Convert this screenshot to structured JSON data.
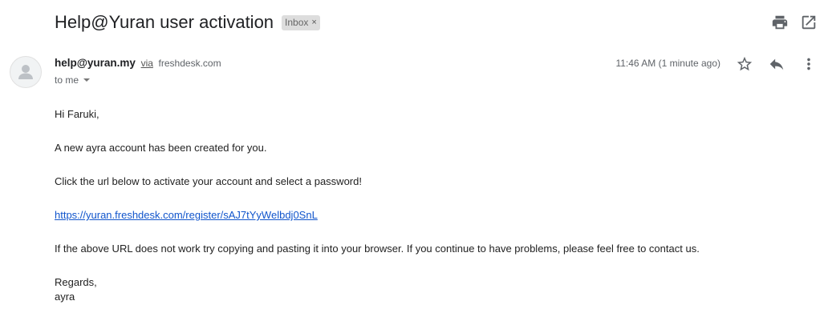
{
  "subject": "Help@Yuran user activation",
  "label": {
    "text": "Inbox",
    "remove_glyph": "×"
  },
  "toolbar_icons": [
    "print-icon",
    "open-in-new-window-icon"
  ],
  "sender": {
    "name": "help@yuran.my",
    "via": "via",
    "via_domain": "freshdesk.com",
    "recipient": "to me"
  },
  "timestamp": "11:46 AM (1 minute ago)",
  "message_actions": [
    "star-icon",
    "reply-icon",
    "more-options-icon"
  ],
  "body": {
    "greeting": "Hi Faruki,",
    "line1": "A new ayra account has been created for you.",
    "line2": "Click the url below to activate your account and select a password!",
    "link": "https://yuran.freshdesk.com/register/sAJ7tYyWelbdj0SnL",
    "line3": "If the above URL does not work try copying and pasting it into your browser. If you continue to have problems, please feel free to contact us.",
    "closing": "Regards,",
    "signature": "ayra"
  },
  "colors": {
    "link": "#1155cc",
    "icon": "#5f6368",
    "chip_bg": "#dddddd"
  }
}
